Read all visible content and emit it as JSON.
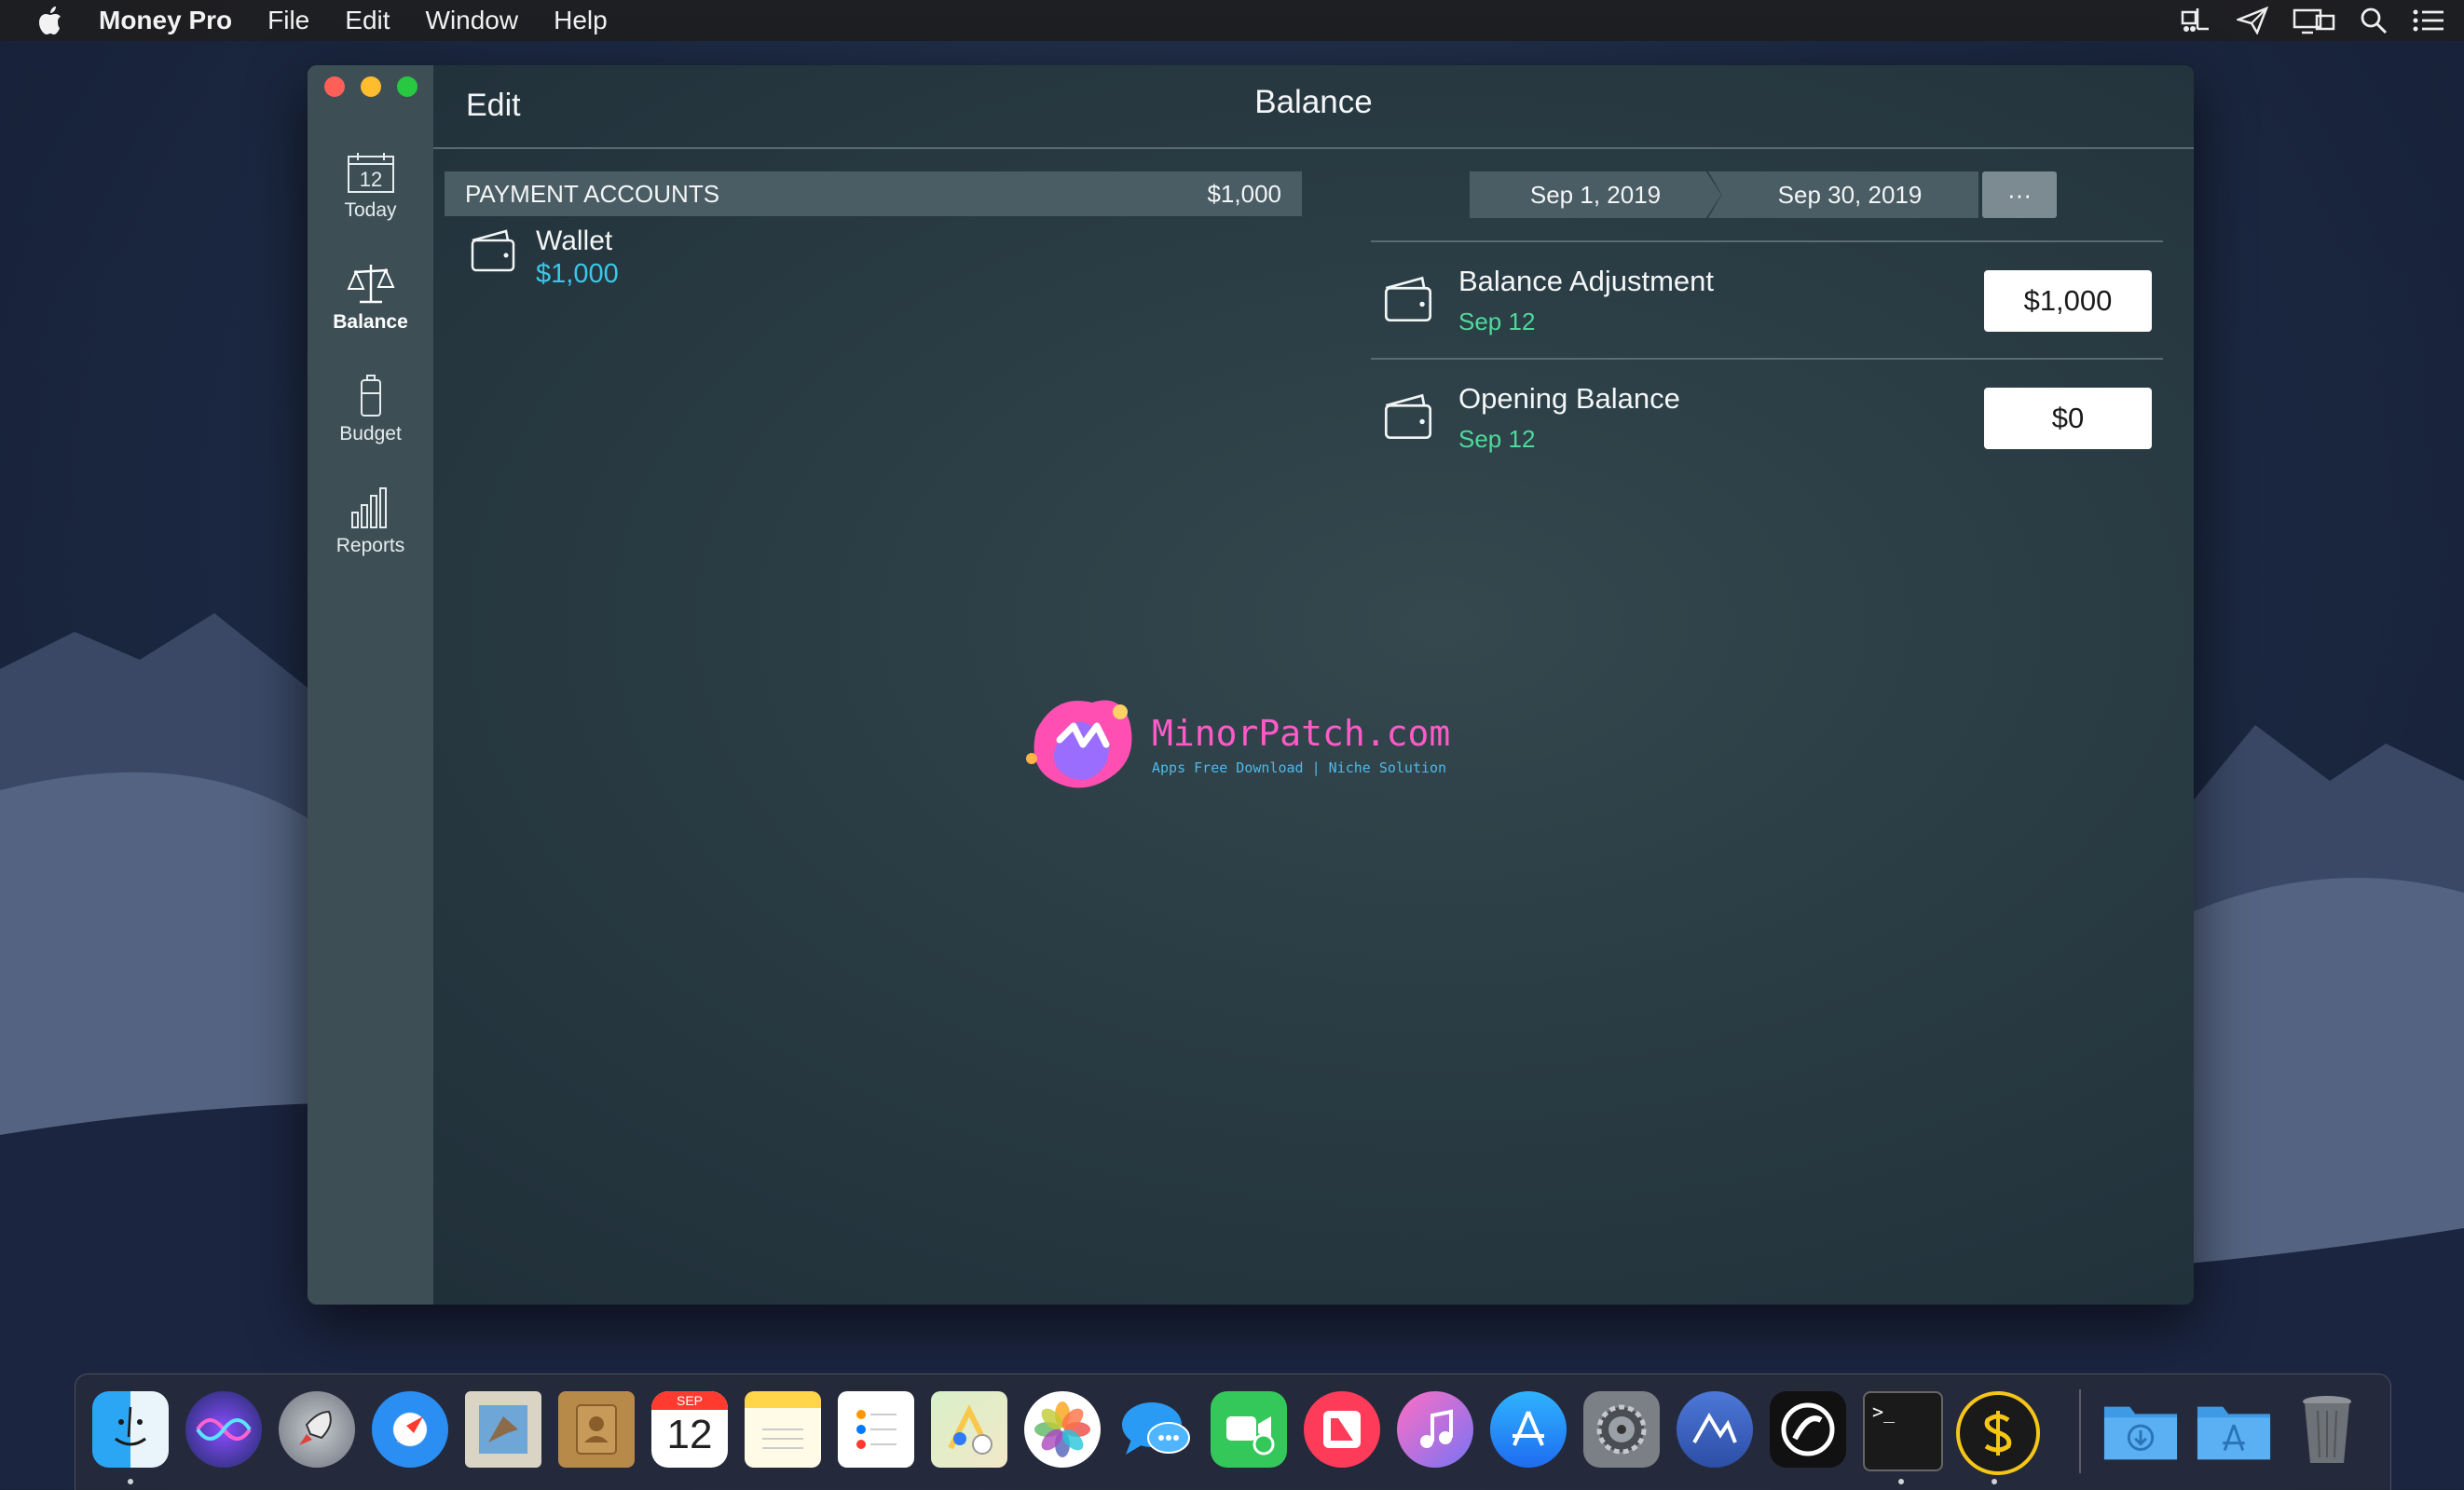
{
  "menubar": {
    "app_name": "Money Pro",
    "items": [
      "File",
      "Edit",
      "Window",
      "Help"
    ]
  },
  "sidebar": {
    "items": [
      {
        "label": "Today",
        "icon": "calendar-icon",
        "calendar_day": "12"
      },
      {
        "label": "Balance",
        "icon": "scale-icon"
      },
      {
        "label": "Budget",
        "icon": "battery-icon"
      },
      {
        "label": "Reports",
        "icon": "bar-chart-icon"
      }
    ]
  },
  "toolbar": {
    "edit_label": "Edit",
    "title": "Balance"
  },
  "accounts": {
    "header_label": "PAYMENT ACCOUNTS",
    "header_total": "$1,000",
    "items": [
      {
        "name": "Wallet",
        "amount": "$1,000"
      }
    ]
  },
  "date_range": {
    "start": "Sep 1, 2019",
    "end": "Sep 30, 2019",
    "more_label": "···"
  },
  "transactions": [
    {
      "name": "Balance Adjustment",
      "date": "Sep 12",
      "amount": "$1,000"
    },
    {
      "name": "Opening Balance",
      "date": "Sep 12",
      "amount": "$0"
    }
  ],
  "watermark": {
    "title": "MinorPatch.com",
    "subtitle": "Apps Free Download | Niche Solution"
  },
  "dock": {
    "calendar_month": "SEP",
    "calendar_day": "12",
    "terminal_prompt": ">_"
  },
  "colors": {
    "accent_blue": "#39c7e8",
    "date_green": "#4fd99a",
    "sidebar_bg": "#3d4f55",
    "header_bg": "#4a5d64"
  }
}
